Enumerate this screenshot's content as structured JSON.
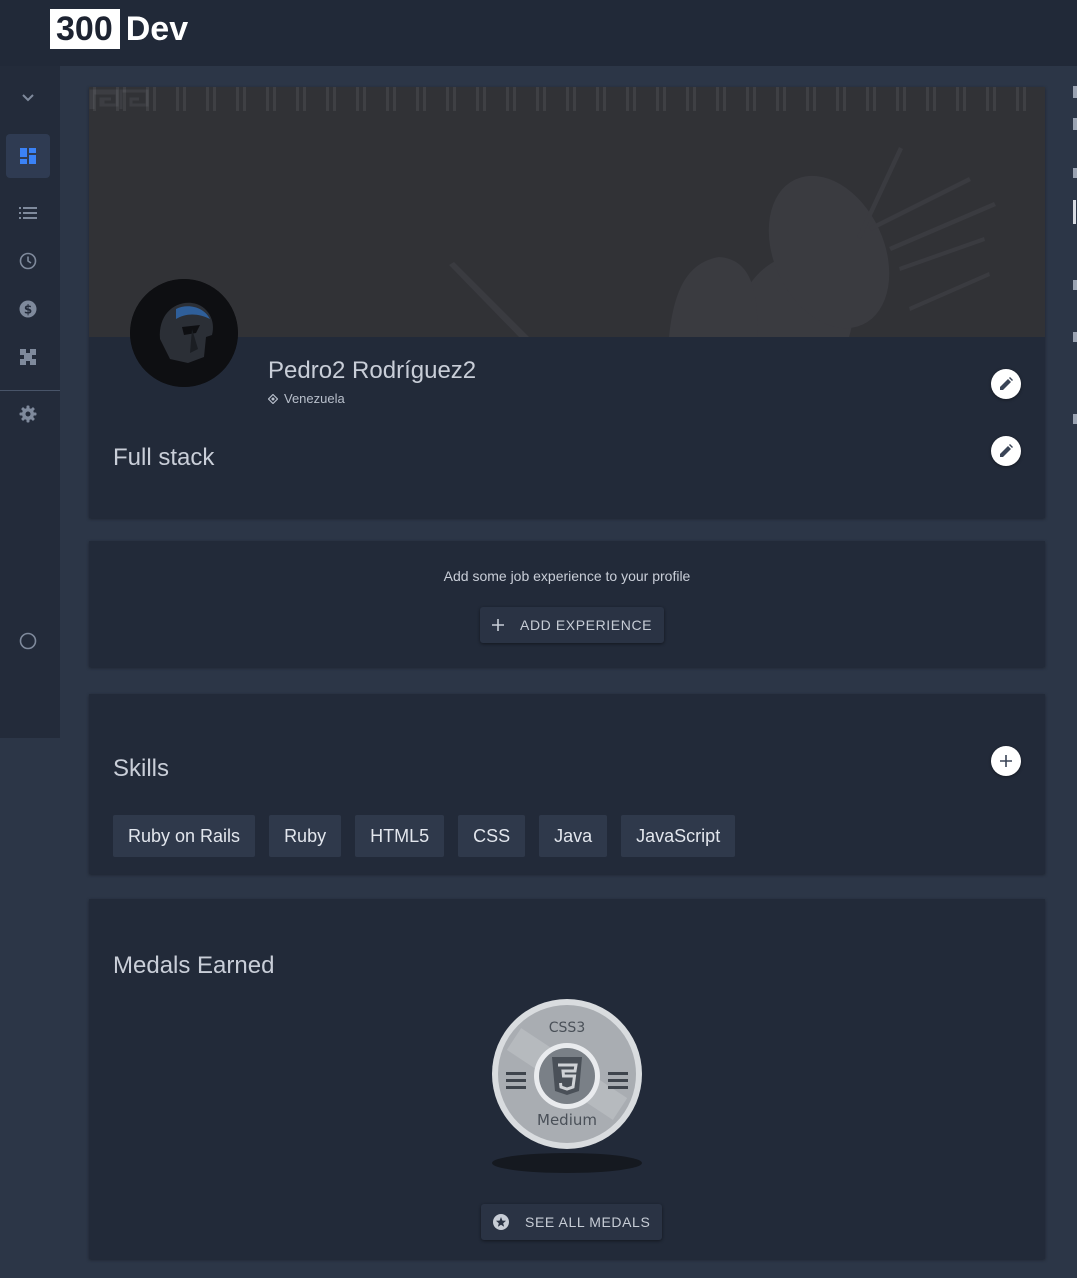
{
  "brand": {
    "number": "300",
    "name": "Dev"
  },
  "sidebar": {
    "items": [
      {
        "icon": "chevron-down-icon",
        "label": ""
      },
      {
        "icon": "dashboard-icon",
        "active": true
      },
      {
        "icon": "list-icon"
      },
      {
        "icon": "clock-icon"
      },
      {
        "icon": "dollar-icon"
      },
      {
        "icon": "puzzle-icon"
      },
      {
        "icon": "gear-icon"
      },
      {
        "icon": "circle-icon"
      }
    ]
  },
  "profile": {
    "name": "Pedro2 Rodríguez2",
    "location": "Venezuela",
    "headline": "Full stack"
  },
  "experience": {
    "empty_text": "Add some job experience to your profile",
    "add_label": "ADD EXPERIENCE"
  },
  "skills": {
    "title": "Skills",
    "items": [
      "Ruby on Rails",
      "Ruby",
      "HTML5",
      "CSS",
      "Java",
      "JavaScript"
    ]
  },
  "medals": {
    "title": "Medals Earned",
    "medal": {
      "name": "CSS3",
      "level": "Medium"
    },
    "see_all_label": "SEE ALL MEDALS"
  },
  "colors": {
    "accent": "#3b82f6",
    "card": "#222a39",
    "page": "#2c3647"
  }
}
